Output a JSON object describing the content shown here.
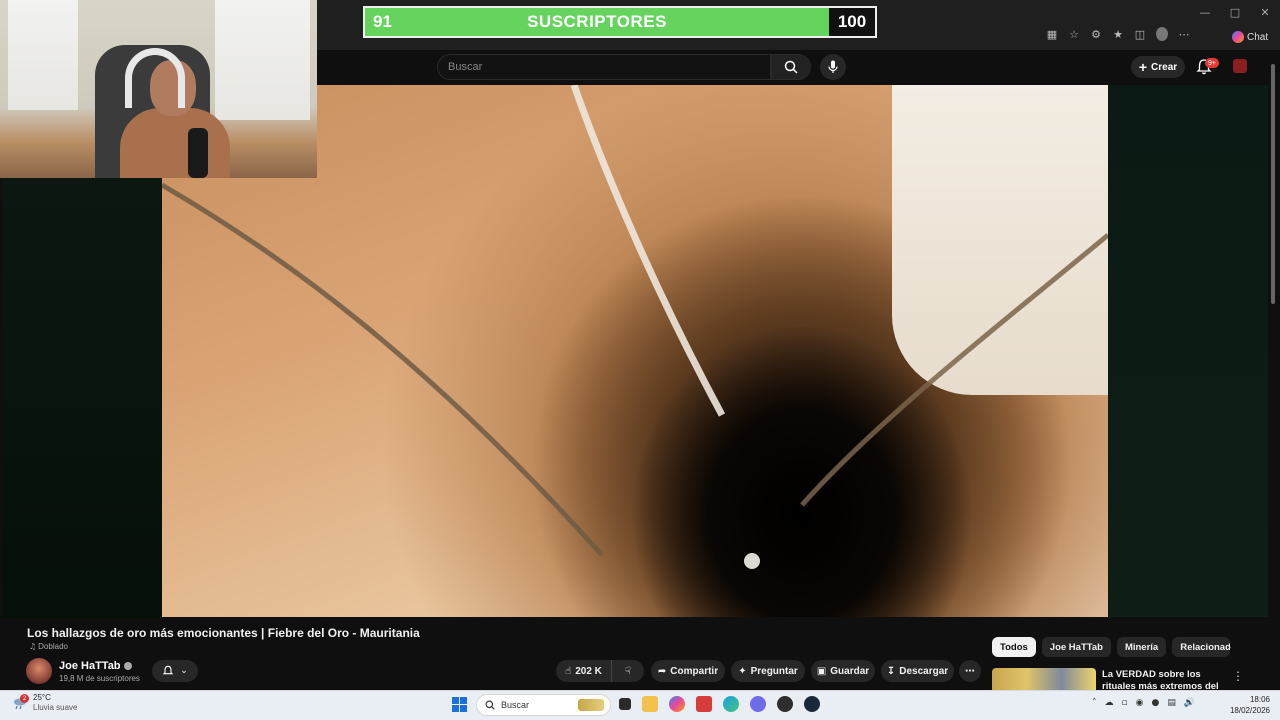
{
  "overlay": {
    "current": "91",
    "label": "SUSCRIPTORES",
    "goal": "100",
    "progress": 0.91
  },
  "browser": {
    "window_controls": [
      "minimize-icon",
      "maximize-icon",
      "close-icon"
    ],
    "chat_label": "Chat"
  },
  "header": {
    "search_placeholder": "Buscar",
    "create_label": "Crear",
    "notifications_badge": "9+"
  },
  "video": {
    "title": "Los hallazgos de oro más emocionantes | Fiebre del Oro - Mauritania",
    "dubbed_label": "Doblado",
    "channel_name": "Joe HaTTab",
    "channel_subs": "19,8 M de suscriptores",
    "like_count": "202 K",
    "share_label": "Compartir",
    "ask_label": "Preguntar",
    "save_label": "Guardar",
    "download_label": "Descargar"
  },
  "chips": [
    "Todos",
    "Joe HaTTab",
    "Minería",
    "Relacionado"
  ],
  "recommended": {
    "title": "La VERDAD sobre los rituales más extremos del mundo: El"
  },
  "taskbar": {
    "weather_temp": "25°C",
    "weather_desc": "Lluvia suave",
    "weather_alerts": "2",
    "search_label": "Buscar",
    "time": "18:06",
    "date": "18/02/2026"
  },
  "colors": {
    "progress_fill": "#65d35e",
    "youtube_bg": "#0f0f0f",
    "badge_red": "#e53935"
  }
}
